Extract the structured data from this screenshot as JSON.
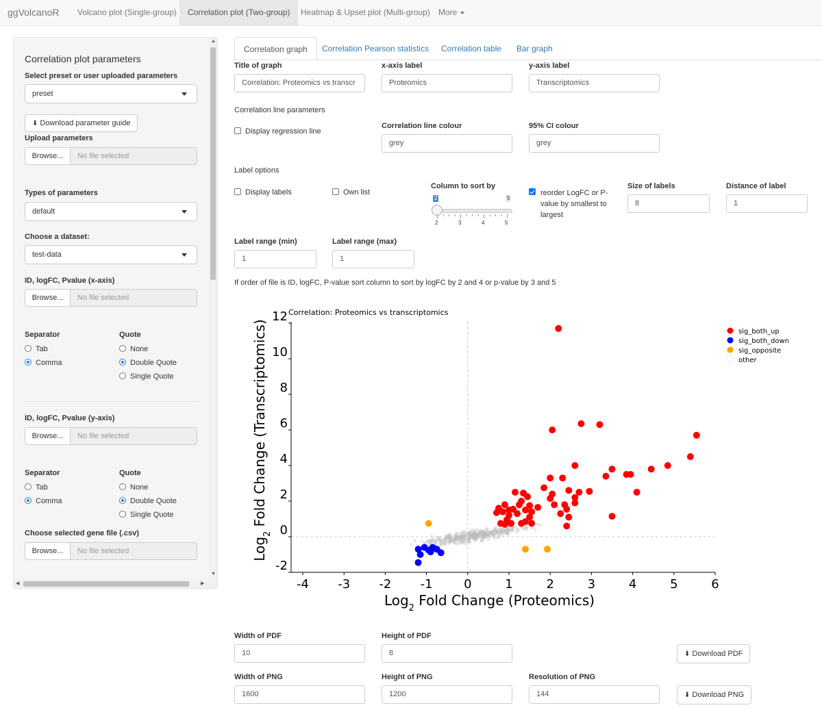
{
  "navbar": {
    "brand": "ggVolcanoR",
    "items": [
      "Volcano plot (Single-group)",
      "Correlation plot (Two-group)",
      "Heatmap & Upset plot (Multi-group)",
      "More"
    ]
  },
  "sidebar": {
    "title": "Correlation plot parameters",
    "preset_label": "Select preset or user uploaded parameters",
    "preset_value": "preset",
    "download_guide": "Download parameter guide",
    "upload_label": "Upload parameters",
    "browse": "Browse...",
    "no_file": "No file selected",
    "types_label": "Types of parameters",
    "types_value": "default",
    "dataset_label": "Choose a dataset:",
    "dataset_value": "test-data",
    "x_file_label": "ID, logFC, Pvalue (x-axis)",
    "y_file_label": "ID, logFC, Pvalue (y-axis)",
    "separator_label": "Separator",
    "separator_options": [
      "Tab",
      "Comma"
    ],
    "quote_label": "Quote",
    "quote_options": [
      "None",
      "Double Quote",
      "Single Quote"
    ],
    "gene_file_label": "Choose selected gene file (.csv)"
  },
  "tabs": [
    "Correlation graph",
    "Correlation Pearson statistics",
    "Correlation table",
    "Bar graph"
  ],
  "form": {
    "title_label": "Title of graph",
    "title_value": "Correlation: Proteomics vs transcr",
    "xaxis_label": "x-axis label",
    "xaxis_value": "Proteomics",
    "yaxis_label": "y-axis label",
    "yaxis_value": "Transcriptomics",
    "corr_section": "Correlation line parameters",
    "display_regression": "Display regression line",
    "line_colour_label": "Correlation line colour",
    "line_colour_value": "grey",
    "ci_colour_label": "95% CI colour",
    "ci_colour_value": "grey",
    "label_section": "Label options",
    "display_labels": "Display labels",
    "own_list": "Own list",
    "sort_label": "Column to sort by",
    "slider": {
      "min": 2,
      "max": 5,
      "value": 2,
      "ticks": [
        "2",
        "3",
        "4",
        "5"
      ],
      "min_text": "2",
      "max_text": "5",
      "value_text": "2"
    },
    "reorder_text_1": "reorder LogFC or P-",
    "reorder_text_2": "value by smallest to",
    "reorder_text_3": "largest",
    "label_size_label": "Size of labels",
    "label_size_value": "8",
    "label_distance_label": "Distance of label",
    "label_distance_value": "1",
    "range_min_label": "Label range (min)",
    "range_min_value": "1",
    "range_max_label": "Label range (max)",
    "range_max_value": "1",
    "help_text": "If order of file is ID, logFC, P-value sort column to sort by logFC by 2 and 4 or p-value by 3 and 5"
  },
  "export": {
    "pdf_width_label": "Width of PDF",
    "pdf_width_value": "10",
    "pdf_height_label": "Height of PDF",
    "pdf_height_value": "8",
    "download_pdf": "Download PDF",
    "png_width_label": "Width of PNG",
    "png_width_value": "1600",
    "png_height_label": "Height of PNG",
    "png_height_value": "1200",
    "png_res_label": "Resolution of PNG",
    "png_res_value": "144",
    "download_png": "Download PNG"
  },
  "colors": {
    "up": "#ff0000",
    "down": "#0000ff",
    "opposite": "#ffa500",
    "other": "#bebebe",
    "link": "#337ab7"
  },
  "chart_data": {
    "type": "scatter",
    "title": "Correlation: Proteomics vs transcriptomics",
    "xlabel_main": "Log",
    "xlabel_sub": "2",
    "xlabel_rest": " Fold Change (Proteomics)",
    "ylabel_main": "Log",
    "ylabel_sub": "2",
    "ylabel_rest": " Fold Change (Transcriptomics)",
    "xlim": [
      -4,
      6
    ],
    "ylim": [
      -2,
      12
    ],
    "x_ticks": [
      -4,
      -3,
      -2,
      -1,
      0,
      1,
      2,
      3,
      4,
      5,
      6
    ],
    "y_ticks": [
      -2,
      0,
      2,
      4,
      6,
      8,
      10,
      12
    ],
    "reference_lines": {
      "x": 0,
      "y": 0
    },
    "legend_position": "top-right",
    "series": [
      {
        "name": "sig_both_up",
        "color": "#ff0000",
        "points": [
          [
            2.2,
            11.7
          ],
          [
            2.05,
            6.0
          ],
          [
            2.75,
            6.35
          ],
          [
            3.2,
            6.3
          ],
          [
            5.55,
            5.7
          ],
          [
            5.4,
            4.5
          ],
          [
            4.85,
            4.0
          ],
          [
            4.45,
            3.8
          ],
          [
            4.1,
            2.5
          ],
          [
            3.85,
            3.5
          ],
          [
            3.95,
            3.5
          ],
          [
            3.5,
            3.8
          ],
          [
            3.35,
            3.4
          ],
          [
            3.5,
            1.15
          ],
          [
            2.95,
            2.55
          ],
          [
            2.6,
            4.0
          ],
          [
            2.3,
            3.3
          ],
          [
            2.0,
            3.3
          ],
          [
            1.85,
            2.75
          ],
          [
            2.05,
            2.4
          ],
          [
            2.45,
            2.6
          ],
          [
            2.0,
            2.15
          ],
          [
            2.1,
            1.8
          ],
          [
            2.35,
            1.8
          ],
          [
            2.6,
            1.9
          ],
          [
            2.4,
            1.55
          ],
          [
            2.25,
            1.3
          ],
          [
            2.45,
            1.1
          ],
          [
            2.4,
            0.6
          ],
          [
            2.7,
            2.5
          ],
          [
            2.6,
            2.2
          ],
          [
            1.15,
            2.5
          ],
          [
            1.35,
            2.45
          ],
          [
            1.45,
            2.25
          ],
          [
            1.3,
            2.0
          ],
          [
            1.25,
            1.8
          ],
          [
            1.5,
            1.75
          ],
          [
            1.4,
            1.5
          ],
          [
            1.55,
            1.4
          ],
          [
            1.1,
            1.55
          ],
          [
            1.2,
            1.3
          ],
          [
            1.5,
            1.1
          ],
          [
            1.4,
            0.85
          ],
          [
            1.55,
            0.75
          ],
          [
            1.3,
            0.75
          ],
          [
            1.0,
            1.5
          ],
          [
            0.85,
            1.4
          ],
          [
            0.7,
            1.35
          ],
          [
            0.75,
            1.6
          ],
          [
            0.9,
            1.8
          ],
          [
            1.0,
            1.2
          ],
          [
            0.95,
            0.95
          ],
          [
            1.05,
            0.75
          ],
          [
            0.9,
            0.7
          ],
          [
            0.8,
            0.75
          ],
          [
            1.7,
            1.65
          ]
        ]
      },
      {
        "name": "sig_both_down",
        "color": "#0000ff",
        "points": [
          [
            -1.2,
            -0.7
          ],
          [
            -1.05,
            -0.6
          ],
          [
            -0.95,
            -0.75
          ],
          [
            -0.9,
            -0.85
          ],
          [
            -0.85,
            -0.6
          ],
          [
            -0.75,
            -0.7
          ],
          [
            -0.65,
            -0.9
          ],
          [
            -1.15,
            -1.0
          ],
          [
            -1.2,
            -1.45
          ]
        ]
      },
      {
        "name": "sig_opposite",
        "color": "#ffa500",
        "points": [
          [
            -0.95,
            0.75
          ],
          [
            1.4,
            -0.7
          ],
          [
            1.93,
            -0.7
          ]
        ]
      },
      {
        "name": "other",
        "color": "#bebebe",
        "points": []
      }
    ]
  }
}
